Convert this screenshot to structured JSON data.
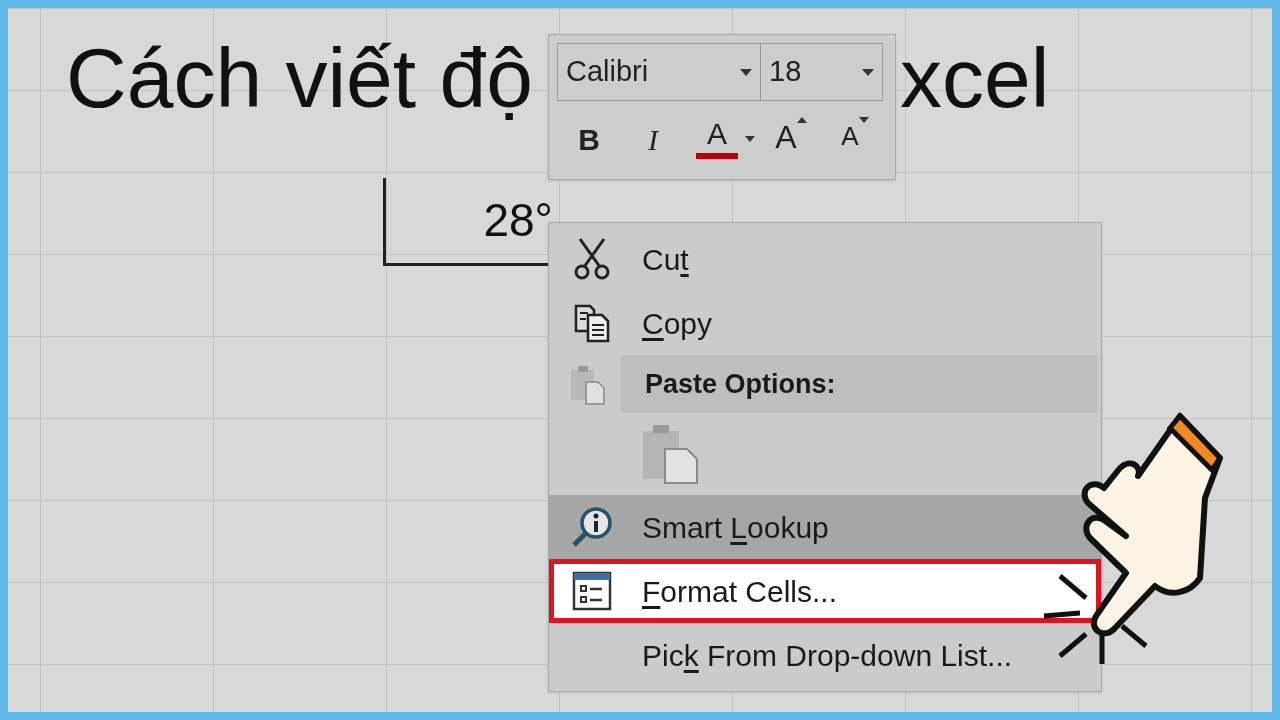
{
  "sheet": {
    "title_left": "Cách viết độ",
    "title_right": "xcel",
    "cell_value": "28°"
  },
  "mini_toolbar": {
    "font": "Calibri",
    "size": "18",
    "buttons": [
      {
        "kind": "bold",
        "label": "B"
      },
      {
        "kind": "italic",
        "label": "I"
      },
      {
        "kind": "font-color",
        "label": "A",
        "color": "#c00000"
      },
      {
        "kind": "grow",
        "label": "A"
      },
      {
        "kind": "shrink",
        "label": "A"
      }
    ]
  },
  "context_menu": {
    "items": [
      {
        "kind": "item",
        "parts": [
          {
            "text": "Cu",
            "underlined": false
          },
          {
            "text": "t",
            "underlined": true
          }
        ],
        "hovered": false,
        "selected": false
      },
      {
        "kind": "item",
        "parts": [
          {
            "text": "C",
            "underlined": true
          },
          {
            "text": "opy",
            "underlined": false
          }
        ],
        "hovered": false,
        "selected": false
      },
      {
        "kind": "header",
        "label": "Paste Options:"
      },
      {
        "kind": "paste-icons"
      },
      {
        "kind": "item",
        "parts": [
          {
            "text": "Smart ",
            "underlined": false
          },
          {
            "text": "L",
            "underlined": true
          },
          {
            "text": "ookup",
            "underlined": false
          }
        ],
        "hovered": true,
        "selected": false
      },
      {
        "kind": "item",
        "parts": [
          {
            "text": "F",
            "underlined": true
          },
          {
            "text": "ormat Cells...",
            "underlined": false
          }
        ],
        "hovered": false,
        "selected": true
      },
      {
        "kind": "item",
        "parts": [
          {
            "text": "Pic",
            "underlined": false
          },
          {
            "text": "k",
            "underlined": true
          },
          {
            "text": " From Drop-down List...",
            "underlined": false
          }
        ],
        "hovered": false,
        "selected": false
      }
    ]
  }
}
